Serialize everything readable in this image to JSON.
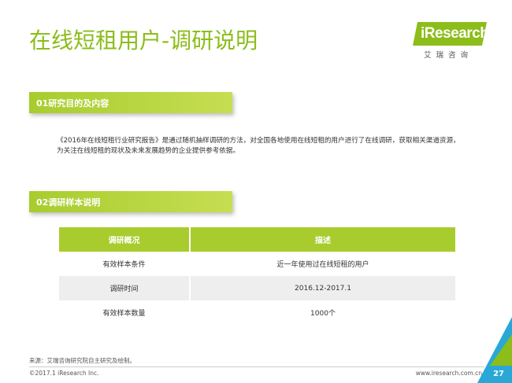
{
  "page": {
    "title": "在线短租用户-调研说明"
  },
  "logo": {
    "name": "iResearch",
    "subtitle": "艾瑞咨询",
    "color": "#8cbd1a"
  },
  "sections": [
    {
      "label": "01研究目的及内容"
    },
    {
      "label": "02调研样本说明"
    }
  ],
  "description": {
    "line1": "《2016年在线短租行业研究报告》是通过随机抽样调研的方法，对全国各地使用在线短租的用户进行了在线调研，获取相关渠道资源，",
    "line2": "为关注在线短租的现状及未来发展趋势的企业提供参考依据。"
  },
  "table": {
    "headers": [
      "调研概况",
      "描述"
    ],
    "rows": [
      [
        "有效样本条件",
        "近一年使用过在线短租的用户"
      ],
      [
        "调研时间",
        "2016.12-2017.1"
      ],
      [
        "有效样本数量",
        "1000个"
      ]
    ]
  },
  "footer": {
    "source": "来源：艾瑞咨询研究院自主研究及绘制。",
    "copyright": "©2017.1 iResearch Inc.",
    "website": "www.iresearch.com.cn",
    "page_number": "27"
  },
  "colors": {
    "accent_green": "#a8cc2e",
    "title_green": "#8cbd1a",
    "corner_cyan": "#29a8d8"
  }
}
